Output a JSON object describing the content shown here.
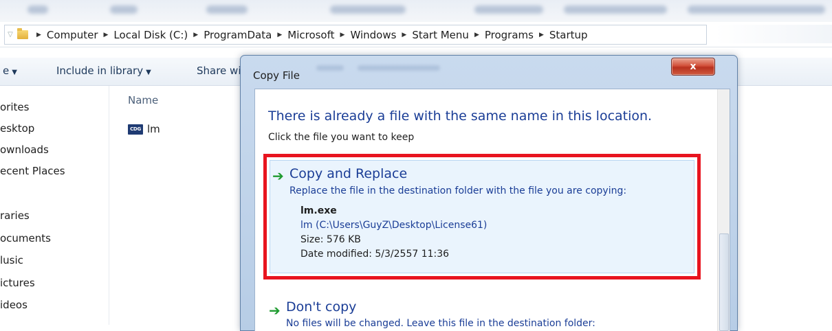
{
  "breadcrumb": {
    "items": [
      "Computer",
      "Local Disk (C:)",
      "ProgramData",
      "Microsoft",
      "Windows",
      "Start Menu",
      "Programs",
      "Startup"
    ]
  },
  "toolbar": {
    "share_partial": "e",
    "include_label": "Include in library",
    "share_with": "Share wi"
  },
  "nav": {
    "items": [
      "orites",
      "esktop",
      "ownloads",
      "ecent Places",
      "raries",
      "ocuments",
      "lusic",
      "ictures",
      "ideos"
    ]
  },
  "filelist": {
    "column_name": "Name",
    "files": [
      {
        "icon": "exe-icon",
        "icon_text": "CDG",
        "name": "lm"
      }
    ]
  },
  "dialog": {
    "title": "Copy File",
    "close_label": "x",
    "heading": "There is already a file with the same name in this location.",
    "subheading": "Click the file you want to keep",
    "options": [
      {
        "title": "Copy and Replace",
        "description": "Replace the file in the destination folder with the file you are copying:",
        "file_name": "lm.exe",
        "file_path": "lm (C:\\Users\\GuyZ\\Desktop\\License61)",
        "size": "Size: 576 KB",
        "date_modified": "Date modified: 5/3/2557 11:36"
      },
      {
        "title": "Don't copy",
        "description": "No files will be changed. Leave this file in the destination folder:"
      }
    ]
  },
  "colors": {
    "accent_blue": "#1a3d96",
    "highlight_red": "#e8141f",
    "arrow_green": "#1f9b30"
  }
}
